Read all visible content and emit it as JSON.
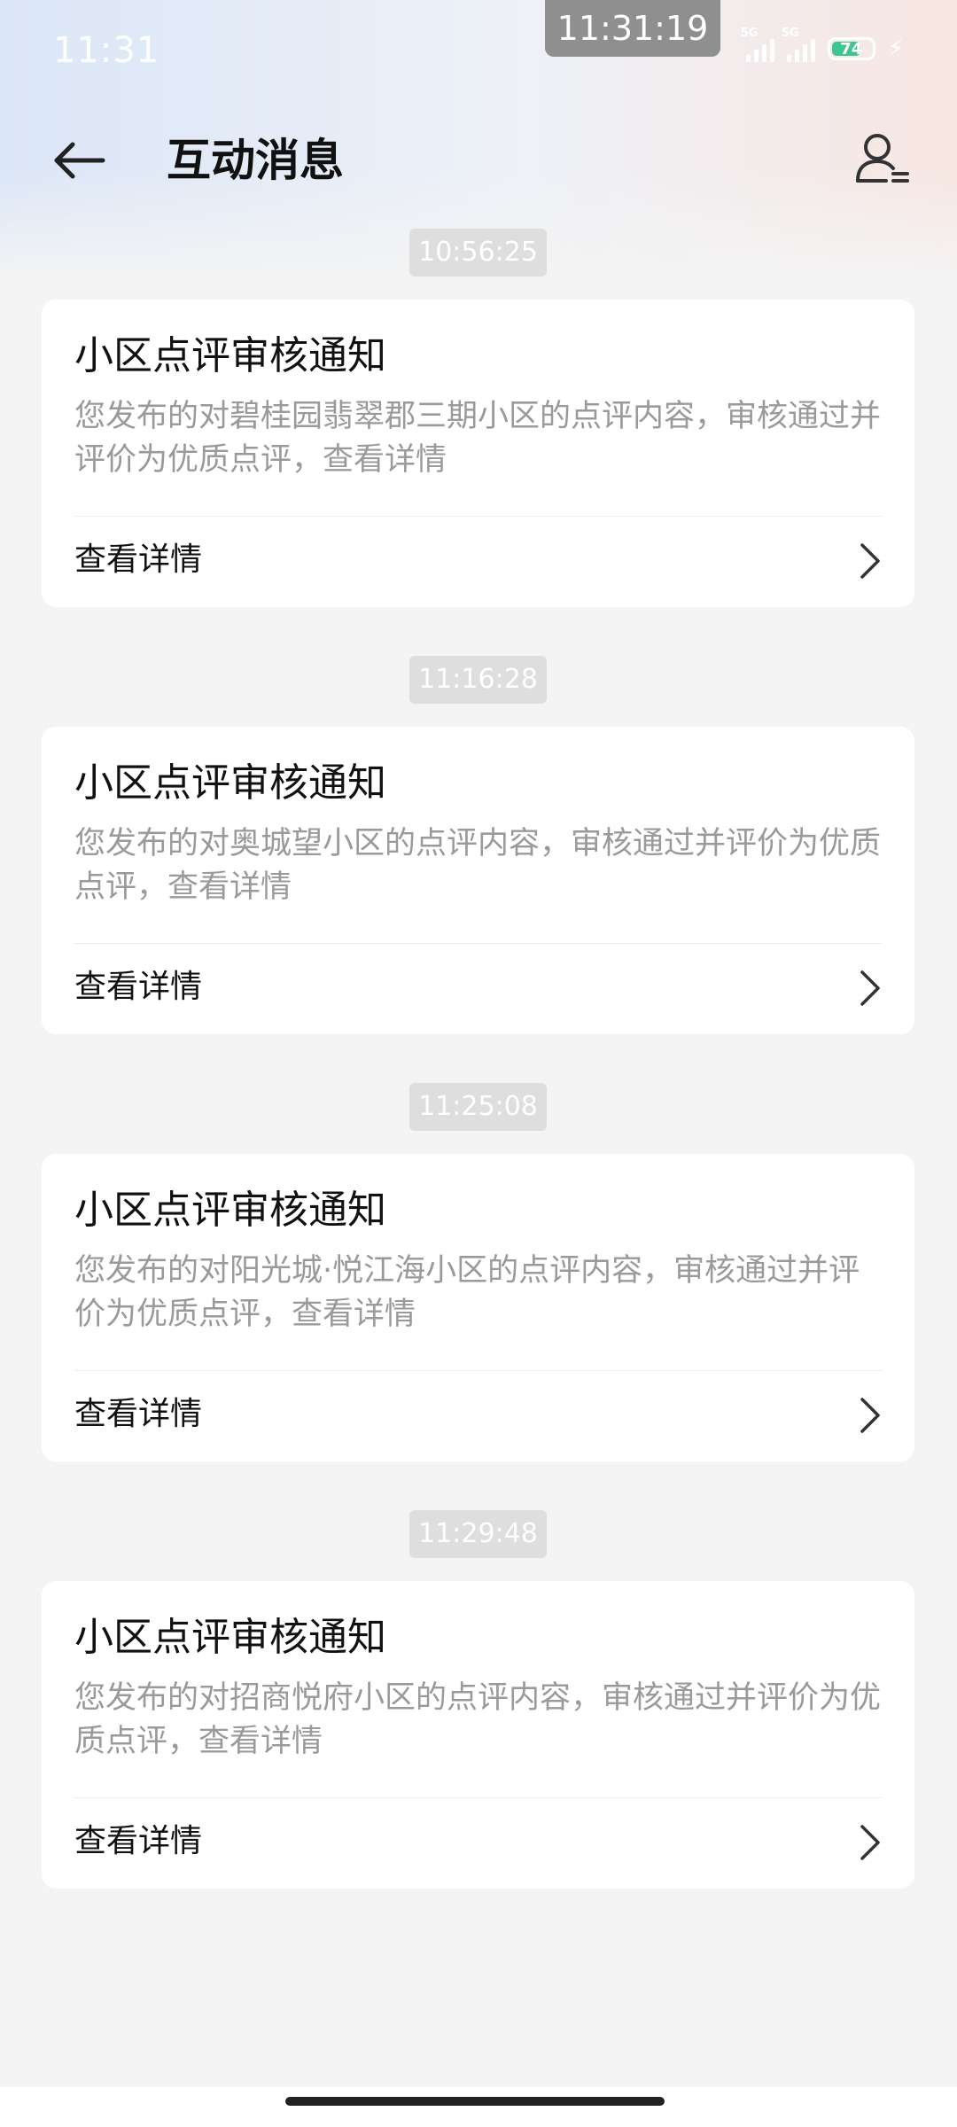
{
  "status_bar": {
    "time": "11:31",
    "clock": "11:31:19",
    "signal_1_tag": "5G",
    "signal_2_tag": "5G",
    "battery_level": "74",
    "battery_fill_fraction": 0.74,
    "battery_color": "#3fc590"
  },
  "header": {
    "title": "互动消息",
    "back_icon": "arrow-left-icon",
    "profile_icon": "user-list-icon"
  },
  "messages": [
    {
      "timestamp": "10:56:25",
      "title": "小区点评审核通知",
      "body": "您发布的对碧桂园翡翠郡三期小区的点评内容，审核通过并评价为优质点评，查看详情",
      "action_label": "查看详情"
    },
    {
      "timestamp": "11:16:28",
      "title": "小区点评审核通知",
      "body": "您发布的对奥城望小区的点评内容，审核通过并评价为优质点评，查看详情",
      "action_label": "查看详情"
    },
    {
      "timestamp": "11:25:08",
      "title": "小区点评审核通知",
      "body": "您发布的对阳光城·悦江海小区的点评内容，审核通过并评价为优质点评，查看详情",
      "action_label": "查看详情"
    },
    {
      "timestamp": "11:29:48",
      "title": "小区点评审核通知",
      "body": "您发布的对招商悦府小区的点评内容，审核通过并评价为优质点评，查看详情",
      "action_label": "查看详情"
    }
  ]
}
